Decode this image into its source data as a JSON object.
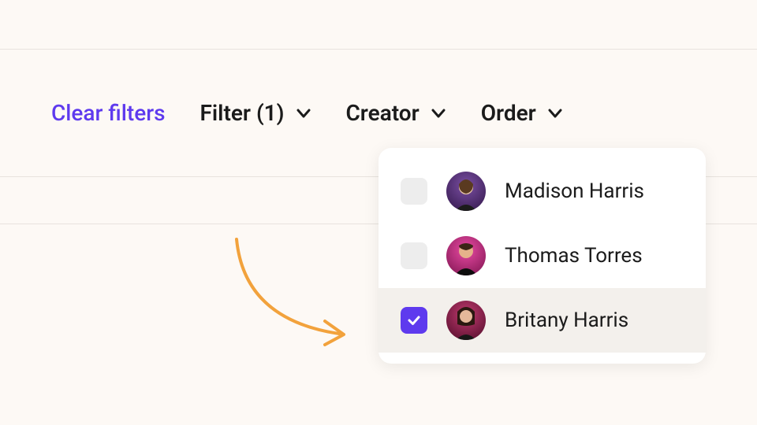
{
  "filterBar": {
    "clearLabel": "Clear filters",
    "filterLabel": "Filter (1)",
    "creatorLabel": "Creator",
    "orderLabel": "Order"
  },
  "creatorDropdown": {
    "options": [
      {
        "name": "Madison Harris",
        "checked": false
      },
      {
        "name": "Thomas Torres",
        "checked": false
      },
      {
        "name": "Britany Harris",
        "checked": true
      }
    ]
  }
}
